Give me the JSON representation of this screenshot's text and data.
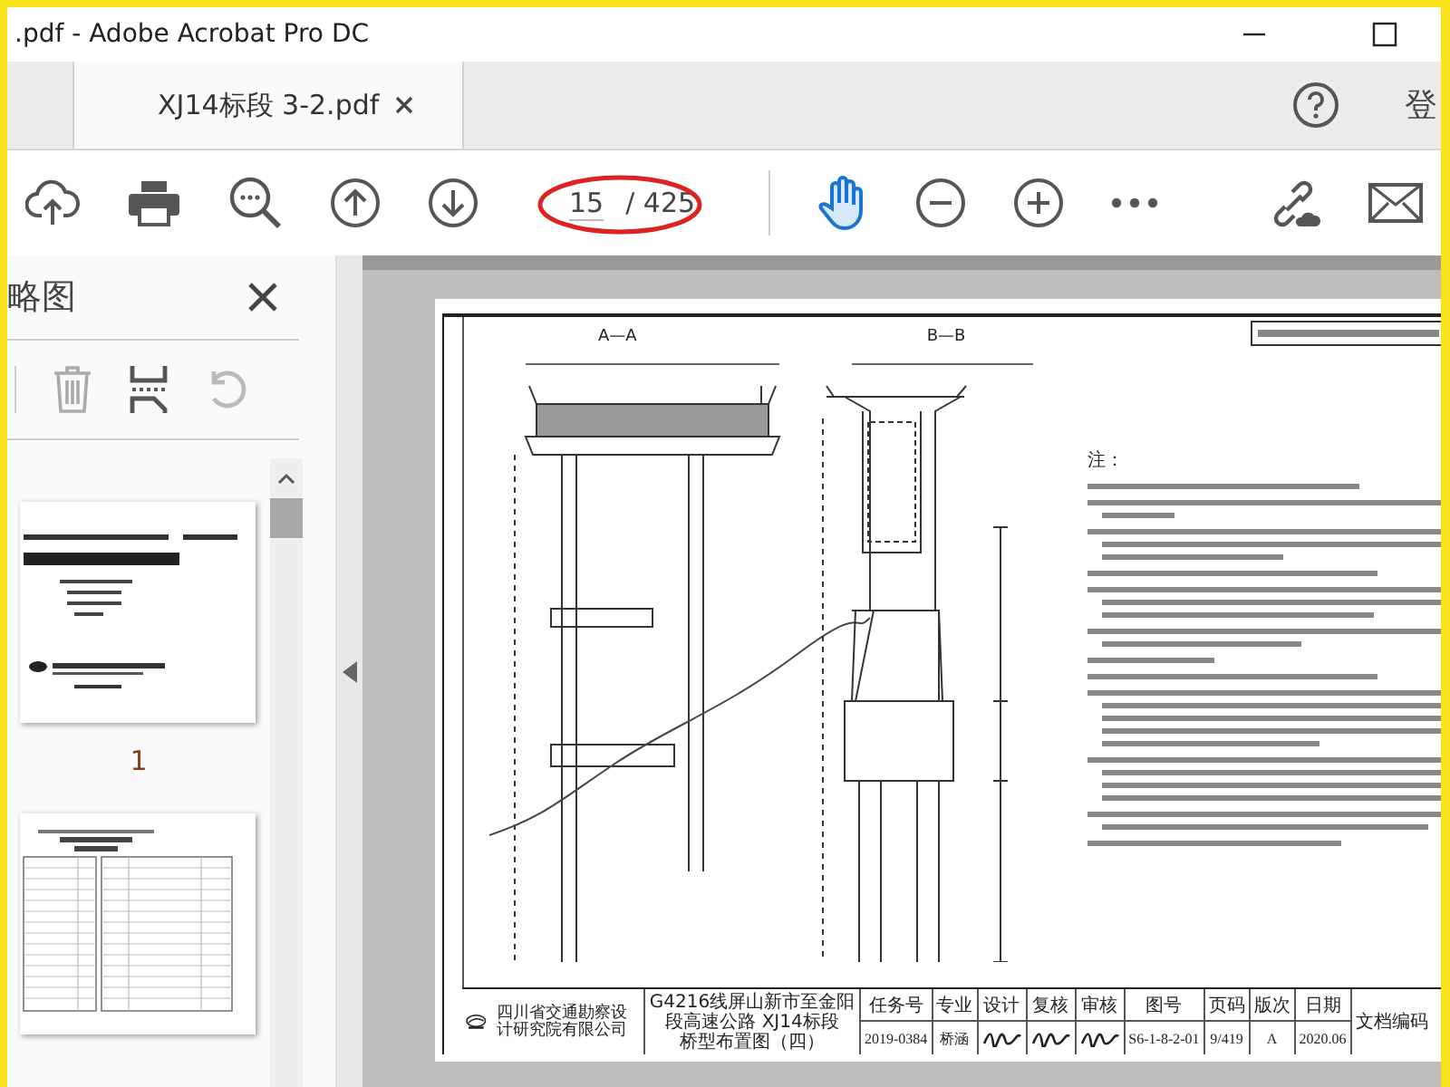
{
  "window": {
    "title": ".pdf - Adobe Acrobat Pro DC"
  },
  "tabs": [
    {
      "label": "XJ14标段 3-2.pdf",
      "selected": true
    }
  ],
  "account_label": "登",
  "toolbar": {
    "page_number": "15",
    "page_total": "/ 425",
    "hand_tool_selected": true
  },
  "sidebar": {
    "title": "略图",
    "thumbnails": [
      {
        "kind": "cover",
        "label": "1"
      },
      {
        "kind": "index"
      }
    ]
  },
  "document": {
    "section_labels": [
      "A—A",
      "B—B"
    ],
    "notes_heading": "注：",
    "title_block": {
      "company": "四川省交通勘察设计研究院有限公司",
      "project": "G4216线屏山新市至金阳段高速公路 XJ14标段",
      "drawing_title": "桥型布置图（四）",
      "columns": [
        {
          "header": "任务号",
          "value": "2019-0384",
          "kind": "text"
        },
        {
          "header": "专业",
          "value": "桥涵",
          "kind": "text"
        },
        {
          "header": "设计",
          "kind": "signature"
        },
        {
          "header": "复核",
          "kind": "signature"
        },
        {
          "header": "审核",
          "kind": "signature"
        },
        {
          "header": "图号",
          "value": "S6-1-8-2-01",
          "kind": "text"
        },
        {
          "header": "页码",
          "value": "9/419",
          "kind": "text"
        },
        {
          "header": "版次",
          "value": "A",
          "kind": "text"
        },
        {
          "header": "日期",
          "value": "2020.06",
          "kind": "text"
        }
      ],
      "doc_code_label": "文档编码"
    }
  }
}
